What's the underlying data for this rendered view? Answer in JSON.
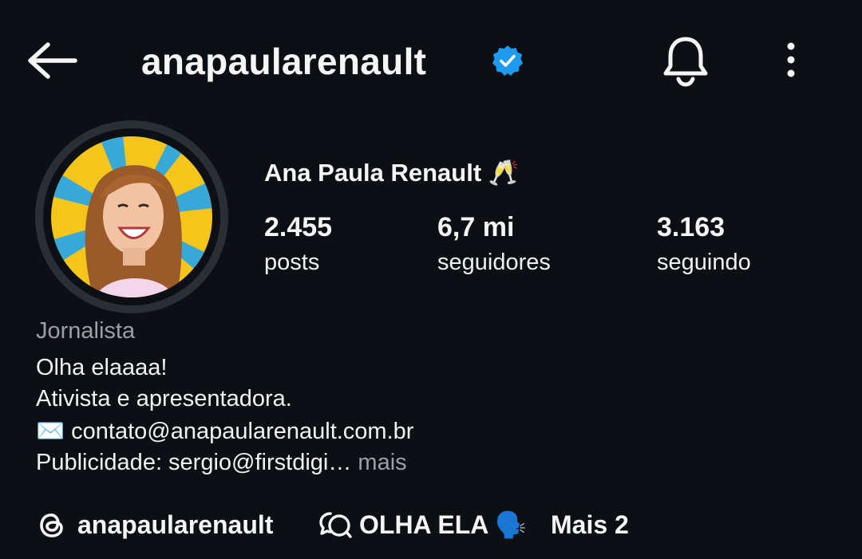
{
  "header": {
    "username": "anapaularenault",
    "verified": true,
    "icons": [
      "back-arrow-icon",
      "verified-badge-icon",
      "bell-icon",
      "more-vertical-icon"
    ]
  },
  "profile": {
    "display_name": "Ana Paula Renault 🥂",
    "stats": [
      {
        "value": "2.455",
        "label": "posts"
      },
      {
        "value": "6,7 mi",
        "label": "seguidores"
      },
      {
        "value": "3.163",
        "label": "seguindo"
      }
    ],
    "category": "Jornalista",
    "bio_lines": [
      "Olha elaaaa!",
      "Ativista e apresentadora.",
      "✉️ contato@anapaularenault.com.br",
      "Publicidade: sergio@firstdigi…"
    ],
    "more_label": "mais"
  },
  "links": {
    "threads_handle": "anapaularenault",
    "channel_label": "OLHA ELA 🗣️",
    "more_links_label": "Mais 2"
  },
  "colors": {
    "background": "#0c0f14",
    "verified_blue": "#1d9bf0",
    "muted_text": "#9aa0a8"
  }
}
